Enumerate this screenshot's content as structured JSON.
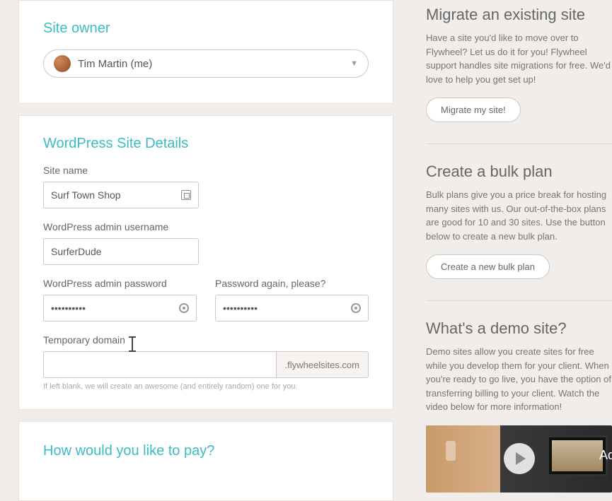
{
  "owner_section": {
    "title": "Site owner",
    "selected": "Tim Martin (me)"
  },
  "details_section": {
    "title": "WordPress Site Details",
    "site_name_label": "Site name",
    "site_name_value": "Surf Town Shop",
    "wp_user_label": "WordPress admin username",
    "wp_user_value": "SurferDude",
    "wp_pass_label": "WordPress admin password",
    "wp_pass_value": "••••••••••",
    "wp_pass2_label": "Password again, please?",
    "wp_pass2_value": "••••••••••",
    "domain_label": "Temporary domain",
    "domain_value": "",
    "domain_suffix": ".flywheelsites.com",
    "domain_helper": "If left blank, we will create an awesome (and entirely random) one for you."
  },
  "pay_section": {
    "title": "How would you like to pay?"
  },
  "sidebar": {
    "migrate": {
      "title": "Migrate an existing site",
      "body": "Have a site you'd like to move over to Flywheel? Let us do it for you! Flywheel support handles site migrations for free. We'd love to help you get set up!",
      "button": "Migrate my site!"
    },
    "bulk": {
      "title": "Create a bulk plan",
      "body": "Bulk plans give you a price break for hosting many sites with us. Our out-of-the-box plans are good for 10 and 30 sites. Use the button below to create a new bulk plan.",
      "button": "Create a new bulk plan"
    },
    "demo": {
      "title": "What's a demo site?",
      "body": "Demo sites allow you create sites for free while you develop them for your client. When you're ready to go live, you have the option of transferring billing to your client. Watch the video below for more information!",
      "ad_label": "Ad"
    }
  }
}
